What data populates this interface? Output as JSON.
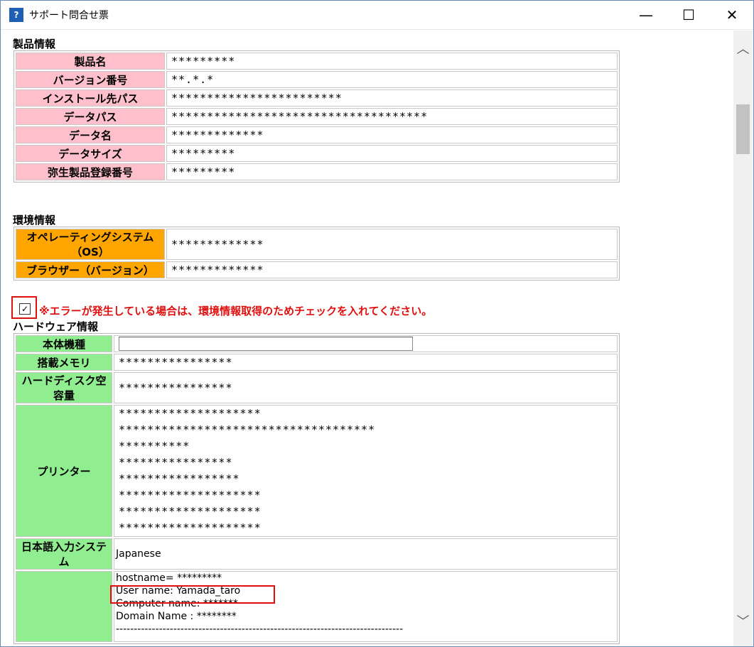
{
  "window": {
    "title": "サポート問合せ票",
    "icon_name": "app-icon",
    "icon_glyph": "?",
    "minimize_glyph": "—",
    "maximize_glyph": "☐",
    "close_glyph": "✕"
  },
  "scrollbar": {
    "up_glyph": "︿",
    "down_glyph": "﹀"
  },
  "product": {
    "title": "製品情報",
    "rows": [
      {
        "label": "製品名",
        "value": "*********"
      },
      {
        "label": "バージョン番号",
        "value": "**.*.*"
      },
      {
        "label": "インストール先パス",
        "value": "************************"
      },
      {
        "label": "データパス",
        "value": "************************************"
      },
      {
        "label": "データ名",
        "value": "*************"
      },
      {
        "label": "データサイズ",
        "value": "*********"
      },
      {
        "label": "弥生製品登録番号",
        "value": "*********"
      }
    ]
  },
  "environment": {
    "title": "環境情報",
    "rows": [
      {
        "label": "オペレーティングシステム（OS）",
        "value": "*************"
      },
      {
        "label": "ブラウザー（バージョン）",
        "value": "*************"
      }
    ]
  },
  "error_check": {
    "checked": true,
    "check_glyph": "✓",
    "message": "※エラーが発生している場合は、環境情報取得のためチェックを入れてください。"
  },
  "hardware": {
    "title": "ハードウェア情報",
    "model_label": "本体機種",
    "model_value": "",
    "memory_label": "搭載メモリ",
    "memory_value": "****************",
    "disk_label": "ハードディスク空容量",
    "disk_value": "****************",
    "printer_label": "プリンター",
    "printers": [
      "********************",
      "************************************",
      "**********",
      "****************",
      "*****************",
      "********************",
      "********************",
      "********************"
    ],
    "ime_label": "日本語入力システム",
    "ime_value": "Japanese",
    "network_lines": [
      "hostname= *********",
      "User name: Yamada_taro",
      "Computer name: *******",
      "Domain Name : ********",
      "--------------------------------------------------------------------------------"
    ]
  }
}
